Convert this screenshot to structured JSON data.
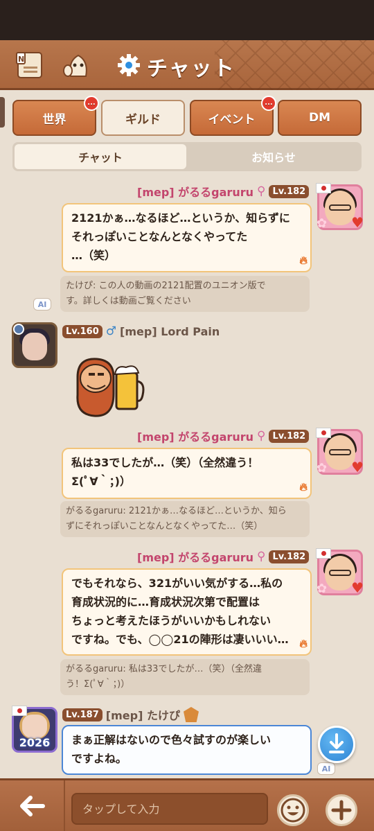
{
  "header": {
    "title": "チャット"
  },
  "tabs": [
    {
      "label": "世界",
      "badge": "..."
    },
    {
      "label": "ギルド"
    },
    {
      "label": "イベント",
      "badge": "..."
    },
    {
      "label": "DM"
    }
  ],
  "subtabs": [
    "チャット",
    "お知らせ"
  ],
  "messages": [
    {
      "name": "[mep] がるるgaruru",
      "level": "Lv.182",
      "text": [
        "2121かぁ…なるほど…というか、知らずに",
        "それっぽいことなんとなくやってた",
        "…（笑）"
      ],
      "quote": [
        "たけぴ: この人の動画の2121配置のユニオン版で",
        "す。詳しくは動画ご覧ください"
      ]
    },
    {
      "name": "[mep] Lord Pain",
      "level": "Lv.160"
    },
    {
      "name": "[mep] がるるgaruru",
      "level": "Lv.182",
      "text": [
        "私は33でしたが…（笑）（全然違う！",
        "Σ(ﾟ∀｀；)）"
      ],
      "quote": [
        "がるるgaruru: 2121かぁ…なるほど…というか、知ら",
        "ずにそれっぽいことなんとなくやってた…（笑）"
      ]
    },
    {
      "name": "[mep] がるるgaruru",
      "level": "Lv.182",
      "text": [
        "でもそれなら、321がいい気がする…私の",
        "育成状況的に…育成状況次第で配置は",
        "ちょっと考えたほうがいいかもしれない",
        "ですね。でも、◯◯21の陣形は凄いいい…"
      ],
      "quote": [
        "がるるgaruru: 私は33でしたが…（笑）（全然違",
        "う！Σ(ﾟ∀｀；)）"
      ]
    },
    {
      "name": "[mep] たけぴ",
      "level": "Lv.187",
      "avatar_year": "2026",
      "text": [
        "まぁ正解はないので色々試すのが楽しい",
        "ですよね。"
      ]
    }
  ],
  "ai_label": "AI",
  "input": {
    "placeholder": "タップして入力"
  },
  "accent": "#a9653c"
}
